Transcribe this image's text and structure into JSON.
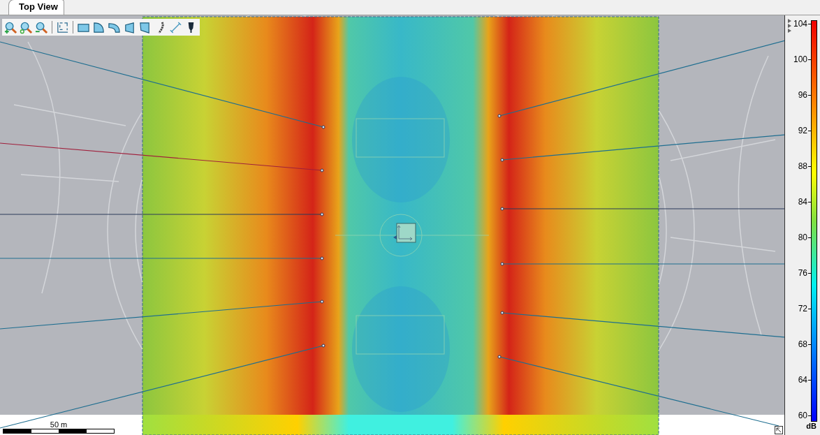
{
  "tabs": [
    {
      "label": "Top View",
      "selected": true
    }
  ],
  "scale_bar": {
    "label": "50 m"
  },
  "color_scale": {
    "ticks": [
      "104",
      "100",
      "96",
      "92",
      "88",
      "84",
      "80",
      "76",
      "72",
      "68",
      "64",
      "60"
    ],
    "unit": "dB"
  }
}
